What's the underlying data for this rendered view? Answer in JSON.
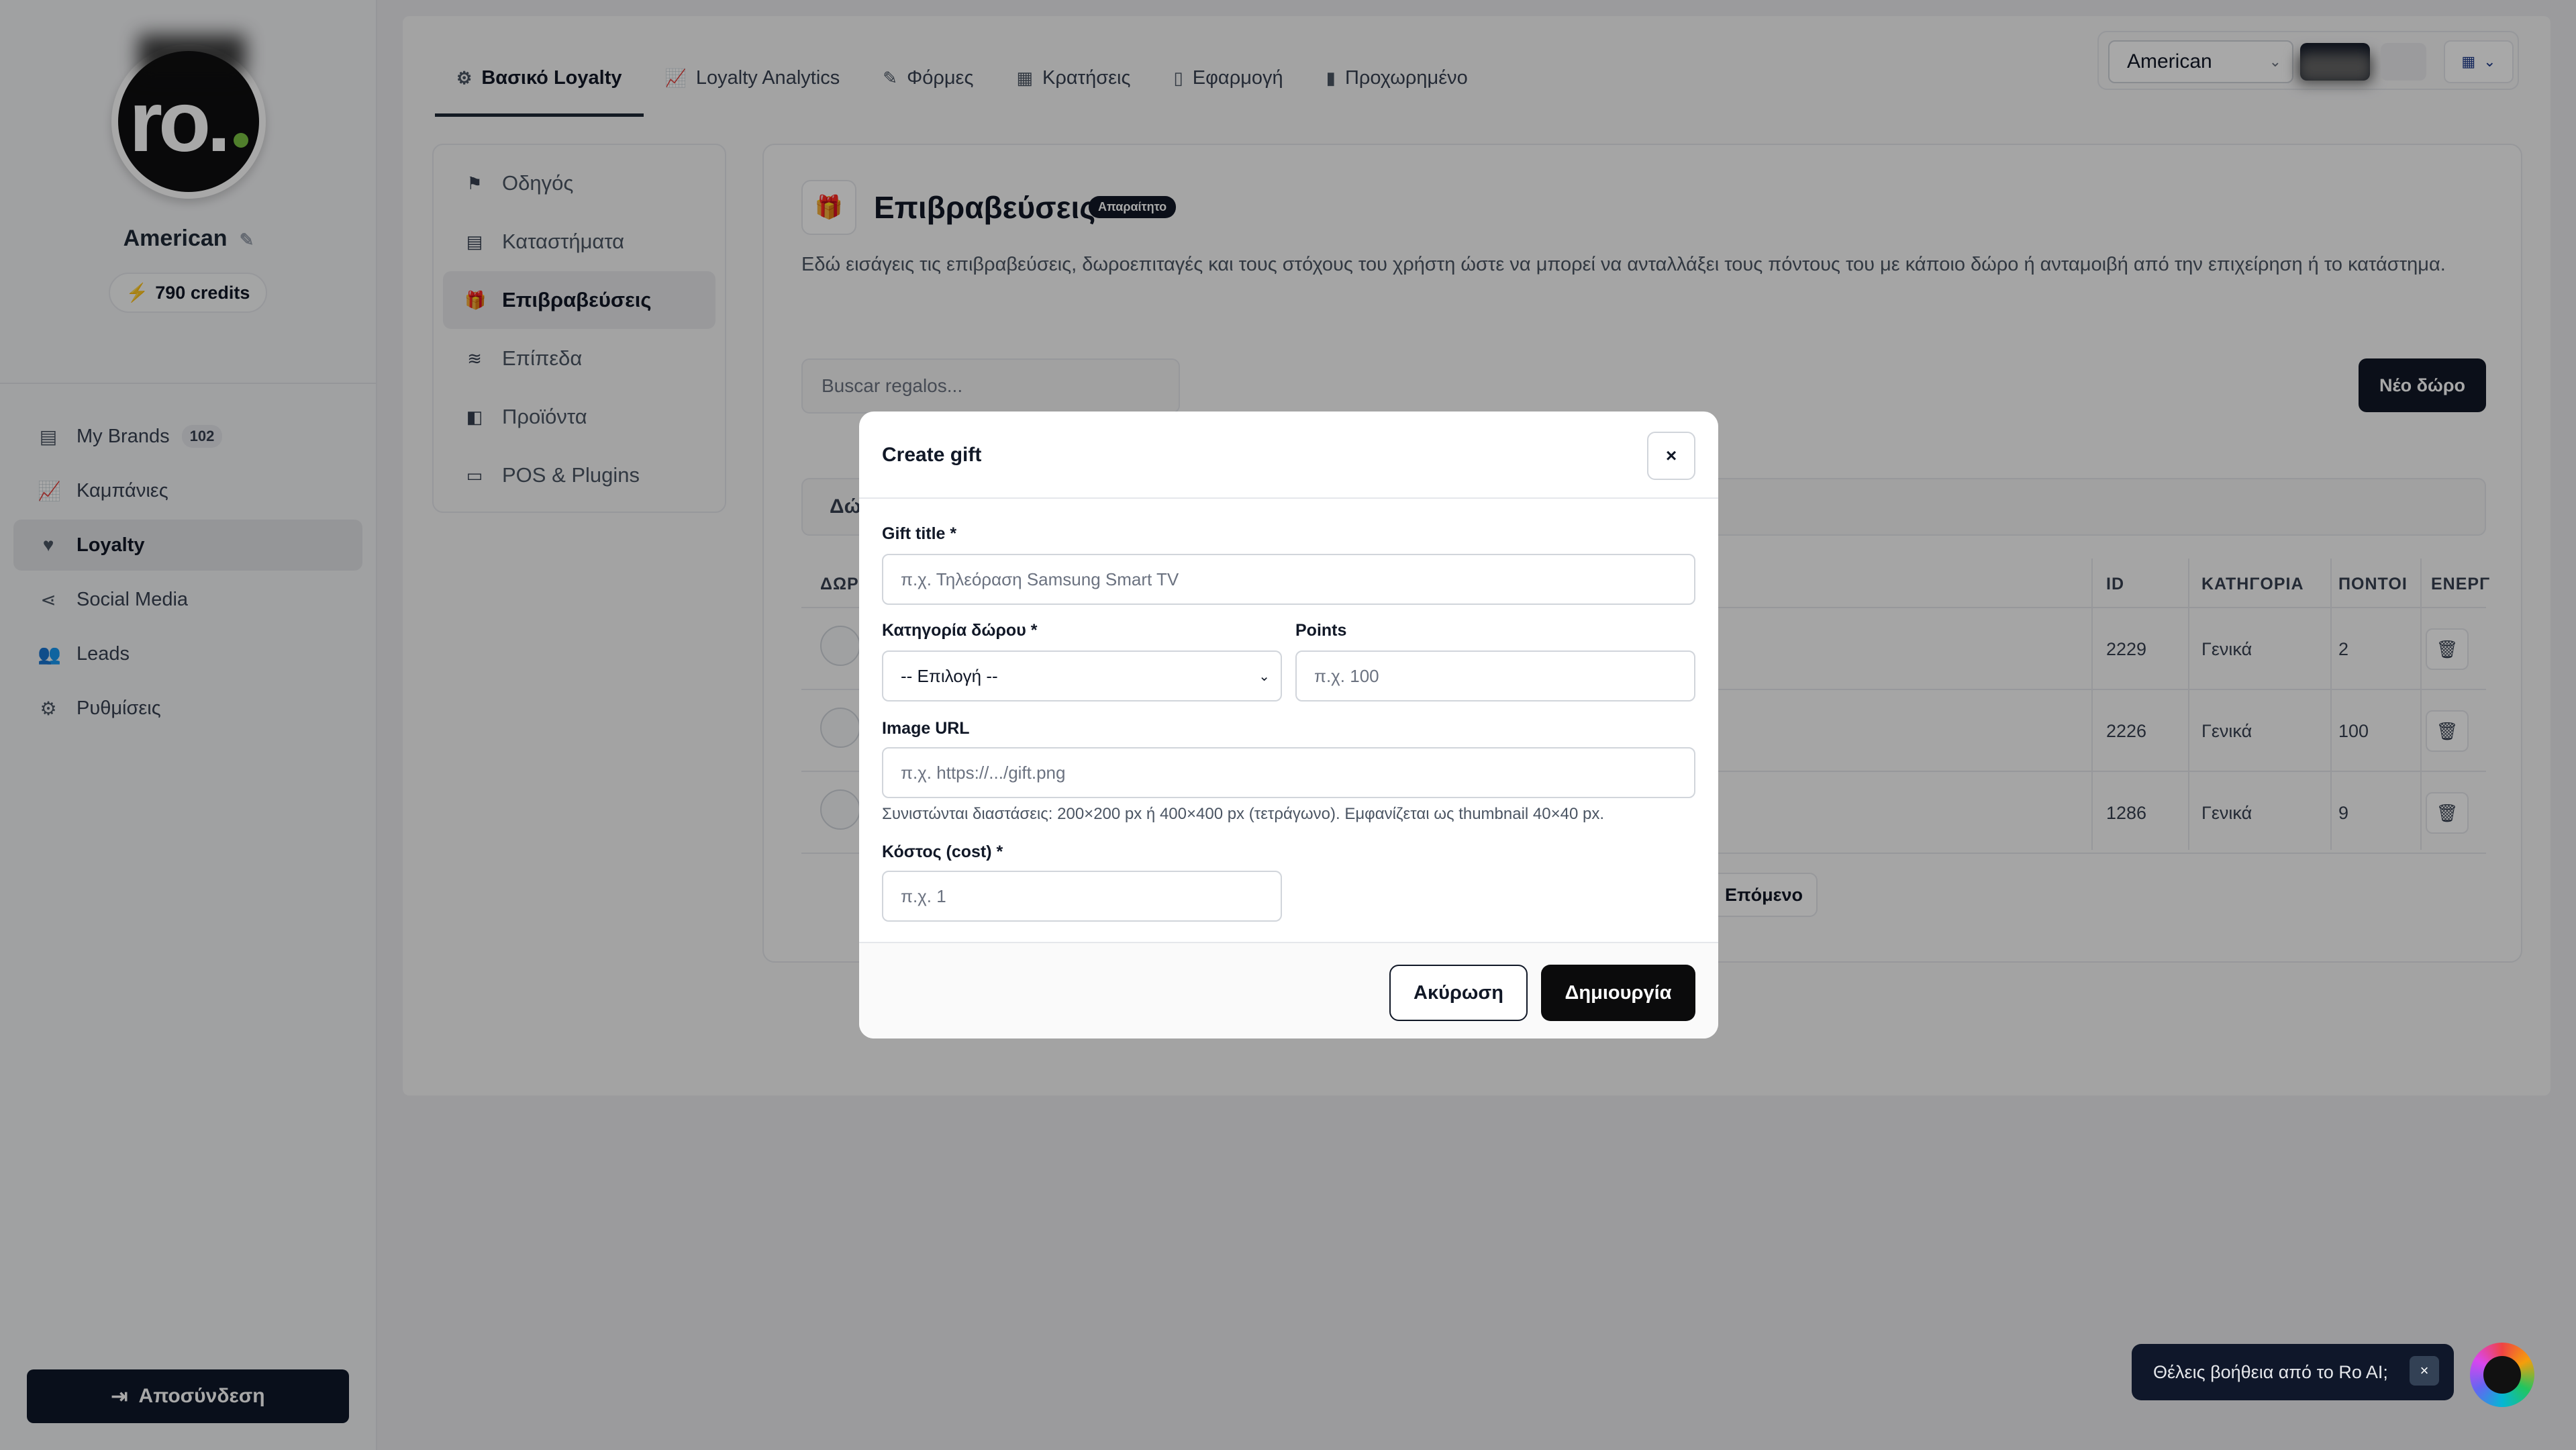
{
  "sidebar": {
    "logo_text": "ro.",
    "brand_name": "American",
    "credits": "790 credits",
    "nav": [
      {
        "label": "My Brands",
        "badge": "102"
      },
      {
        "label": "Καμπάνιες"
      },
      {
        "label": "Loyalty"
      },
      {
        "label": "Social Media"
      },
      {
        "label": "Leads"
      },
      {
        "label": "Ρυθμίσεις"
      }
    ],
    "logout": "Αποσύνδεση"
  },
  "tabs": [
    "Βασικό Loyalty",
    "Loyalty Analytics",
    "Φόρμες",
    "Κρατήσεις",
    "Εφαρμογή",
    "Προχωρημένο"
  ],
  "topbar": {
    "brand_select": "American"
  },
  "subnav": [
    "Οδηγός",
    "Καταστήματα",
    "Επιβραβεύσεις",
    "Επίπεδα",
    "Προϊόντα",
    "POS & Plugins"
  ],
  "content": {
    "title": "Επιβραβεύσεις",
    "required_badge": "Απαραίτητο",
    "description": "Εδώ εισάγεις τις επιβραβεύσεις, δωροεπιταγές και τους στόχους του χρήστη ώστε να μπορεί να ανταλλάξει τους πόντους του με κάποιο δώρο ή ανταμοιβή από την επιχείρηση ή το κατάστημα.",
    "search_placeholder": "Buscar regalos...",
    "new_button": "Νέο δώρο",
    "filter_label": "Δώ",
    "columns": {
      "gift": "ΔΩΡΟ",
      "id": "ID",
      "category": "ΚΑΤΗΓΟΡΙΑ",
      "points": "ΠΟΝΤΟΙ",
      "active": "ΕΝΕΡΓ"
    },
    "rows": [
      {
        "id": "2229",
        "category": "Γενικά",
        "points": "2"
      },
      {
        "id": "2226",
        "category": "Γενικά",
        "points": "100"
      },
      {
        "id": "1286",
        "category": "Γενικά",
        "points": "9"
      }
    ],
    "next_button": "Επόμενο"
  },
  "modal": {
    "title": "Create gift",
    "close": "×",
    "gift_title_label": "Gift title *",
    "gift_title_placeholder": "π.χ. Τηλεόραση Samsung Smart TV",
    "category_label": "Κατηγορία δώρου *",
    "category_value": "-- Επιλογή --",
    "points_label": "Points",
    "points_placeholder": "π.χ. 100",
    "image_label": "Image URL",
    "image_placeholder": "π.χ. https://.../gift.png",
    "image_hint": "Συνιστώνται διαστάσεις: 200×200 px ή 400×400 px (τετράγωνο). Εμφανίζεται ως thumbnail 40×40 px.",
    "cost_label": "Κόστος (cost) *",
    "cost_placeholder": "π.χ. 1",
    "cancel": "Ακύρωση",
    "create": "Δημιουργία"
  },
  "assistant": {
    "prompt": "Θέλεις βοήθεια από το Ro AI;",
    "close": "×"
  }
}
